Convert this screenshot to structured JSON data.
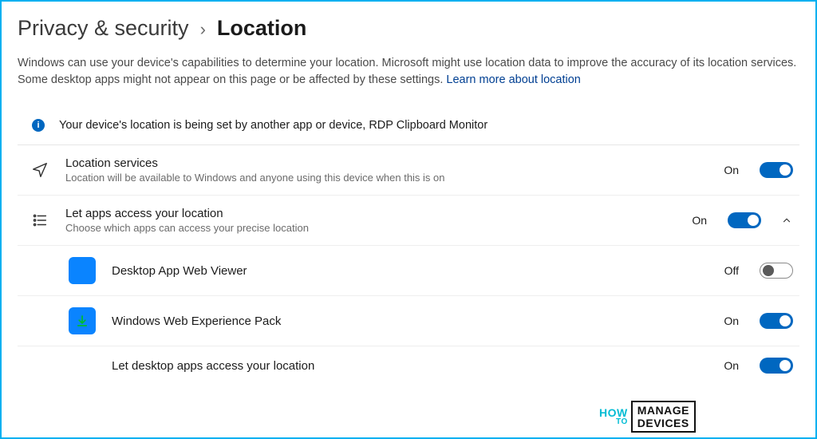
{
  "breadcrumb": {
    "parent": "Privacy & security",
    "current": "Location"
  },
  "intro": {
    "text": "Windows can use your device's capabilities to determine your location. Microsoft might use location data to improve the accuracy of its location services. Some desktop apps might not appear on this page or be affected by these settings.  ",
    "link": "Learn more about location"
  },
  "banner": {
    "message": "Your device's location is being set by another app or device, RDP Clipboard Monitor"
  },
  "rows": {
    "location_services": {
      "title": "Location services",
      "desc": "Location will be available to Windows and anyone using this device when this is on",
      "state": "On",
      "on": true
    },
    "apps_access": {
      "title": "Let apps access your location",
      "desc": "Choose which apps can access your precise location",
      "state": "On",
      "on": true,
      "expanded": true
    },
    "desktop_web_viewer": {
      "title": "Desktop App Web Viewer",
      "state": "Off",
      "on": false
    },
    "web_experience": {
      "title": "Windows Web Experience Pack",
      "state": "On",
      "on": true
    },
    "desktop_apps": {
      "title": "Let desktop apps access your location",
      "state": "On",
      "on": true
    }
  },
  "watermark": {
    "how": "HOW",
    "to": "TO",
    "manage": "MANAGE",
    "devices": "DEVICES"
  }
}
